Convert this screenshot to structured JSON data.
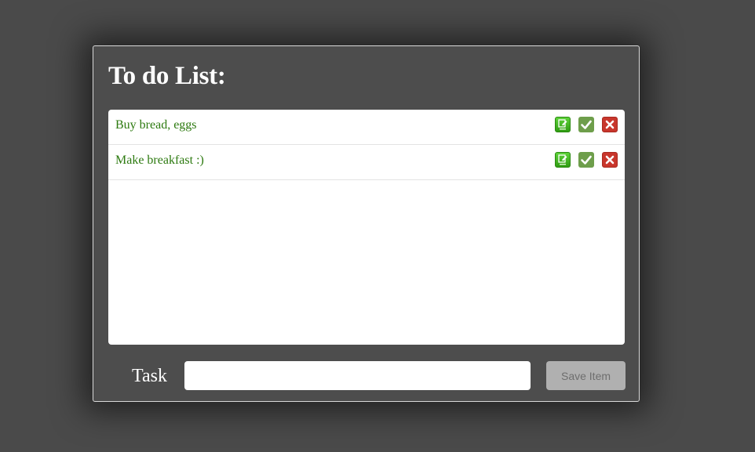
{
  "todo": {
    "title": "To do List:",
    "items": [
      {
        "label": "Buy bread, eggs"
      },
      {
        "label": "Make breakfast :)"
      }
    ]
  },
  "form": {
    "task_label": "Task",
    "task_value": "",
    "save_label": "Save Item"
  },
  "icons": {
    "edit": "edit-icon",
    "check": "check-icon",
    "delete": "close-icon"
  },
  "colors": {
    "background": "#4a4a4a",
    "panel": "#4d4d4d",
    "item_text": "#2d7a10",
    "edit": "#3ab41c",
    "check": "#6e9e4b",
    "delete": "#c8362c",
    "save_button": "#b0b0b0"
  }
}
